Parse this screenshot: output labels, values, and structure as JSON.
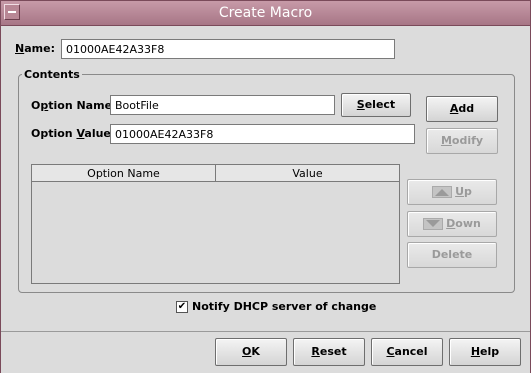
{
  "window": {
    "title": "Create Macro"
  },
  "name": {
    "label_key": "N",
    "label_rest": "ame:",
    "value": "01000AE42A33F8"
  },
  "contents": {
    "title": "Contents",
    "option_name": {
      "label_pre": "O",
      "label_key": "p",
      "label_rest": "tion Name:",
      "value": "BootFile"
    },
    "option_value": {
      "label_pre": "Option ",
      "label_key": "V",
      "label_rest": "alue:",
      "value": "01000AE42A33F8"
    },
    "select_button": {
      "key": "S",
      "rest": "elect"
    },
    "add_button": {
      "key": "A",
      "rest": "dd"
    },
    "modify_button": {
      "key": "M",
      "rest": "odify"
    },
    "up_button": {
      "key": "U",
      "rest": "p"
    },
    "down_button": {
      "key": "D",
      "rest": "own"
    },
    "delete_button": {
      "label": "Delete"
    },
    "table": {
      "columns": [
        "Option Name",
        "Value"
      ],
      "rows": []
    }
  },
  "notify": {
    "label": "Notify DHCP server of change",
    "checked": true,
    "checkmark": "✔"
  },
  "footer": {
    "ok": {
      "key": "O",
      "rest": "K"
    },
    "reset": {
      "key": "R",
      "rest": "eset"
    },
    "cancel": {
      "key": "C",
      "rest": "ancel"
    },
    "help": {
      "key": "H",
      "rest": "elp"
    }
  },
  "colors": {
    "titlebar": "#b07f8f",
    "background": "#dcdcdc",
    "disabled_text": "#9a9a9a"
  }
}
